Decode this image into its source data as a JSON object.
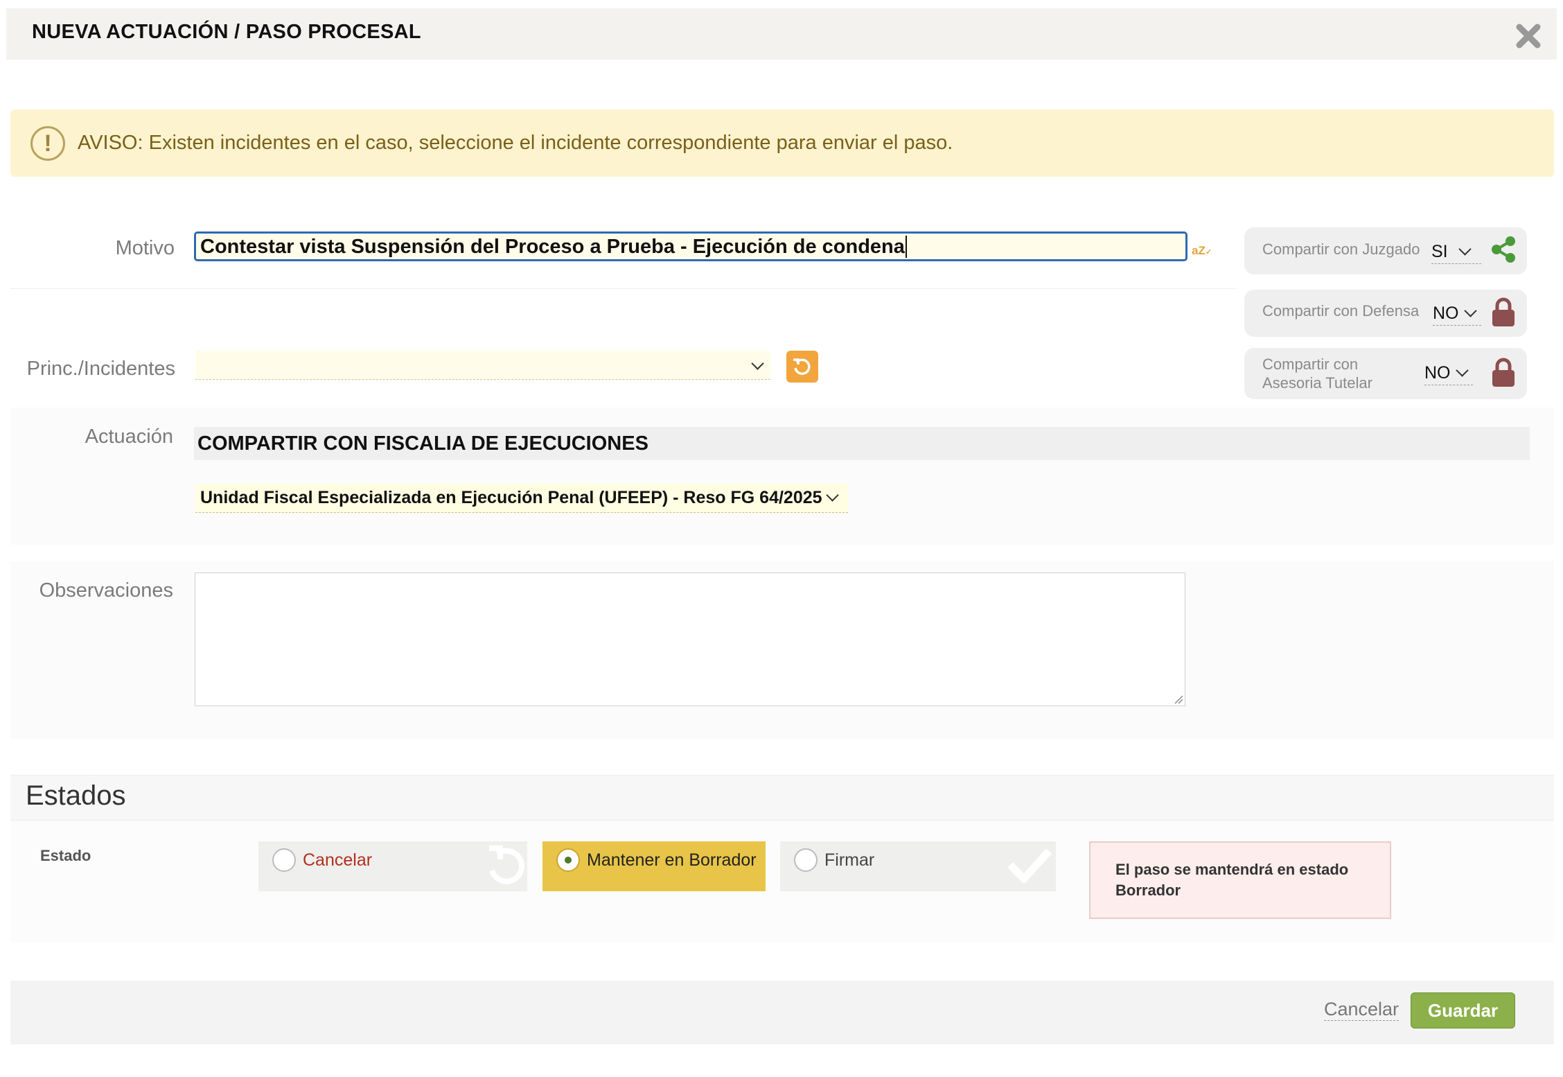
{
  "header": {
    "title": "NUEVA ACTUACIÓN / PASO PROCESAL"
  },
  "warning": {
    "text": "AVISO: Existen incidentes en el caso, seleccione el incidente correspondiente para enviar el paso.",
    "icon": "exclamation-circle-icon"
  },
  "motivo": {
    "label": "Motivo",
    "value": "Contestar vista Suspensión del Proceso a Prueba - Ejecución de condena"
  },
  "sharing": {
    "juzgado": {
      "label": "Compartir con Juzgado",
      "value": "SI",
      "icon": "share-icon"
    },
    "defensa": {
      "label": "Compartir con Defensa",
      "value": "NO",
      "icon": "lock-icon"
    },
    "asesoria": {
      "label_line1": "Compartir con",
      "label_line2": "Asesoria Tutelar",
      "value": "NO",
      "icon": "lock-icon"
    }
  },
  "princ": {
    "label": "Princ./Incidentes",
    "value": ""
  },
  "actuacion": {
    "label": "Actuación",
    "title": "COMPARTIR CON FISCALIA DE EJECUCIONES",
    "unidad": "Unidad Fiscal Especializada en Ejecución Penal (UFEEP) - Reso FG 64/2025"
  },
  "observaciones": {
    "label": "Observaciones",
    "value": ""
  },
  "estados": {
    "title": "Estados",
    "label": "Estado",
    "options": [
      {
        "label": "Cancelar",
        "selected": false
      },
      {
        "label": "Mantener en Borrador",
        "selected": true
      },
      {
        "label": "Firmar",
        "selected": false
      }
    ],
    "status_message": "El paso se mantendrá en estado Borrador"
  },
  "footer": {
    "cancel_label": "Cancelar",
    "save_label": "Guardar"
  },
  "colors": {
    "accent_green": "#8cb04a",
    "warning_bg": "#fdf3cf",
    "selected_option": "#e8c548",
    "lock": "#8c4e4e",
    "share": "#4a9a3c"
  }
}
